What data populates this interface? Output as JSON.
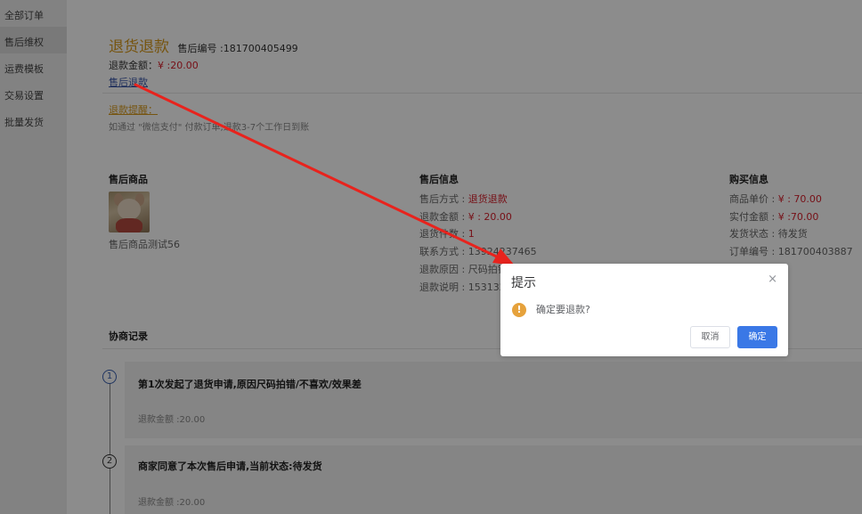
{
  "sidebar": {
    "items": [
      {
        "label": "全部订单"
      },
      {
        "label": "售后维权"
      },
      {
        "label": "运费模板"
      },
      {
        "label": "交易设置"
      },
      {
        "label": "批量发货"
      }
    ]
  },
  "header": {
    "title": "退货退款",
    "number_label": "售后编号 :181700405499",
    "refund_label": "退款金额：",
    "refund_value": "¥ :20.00",
    "link": "售后退款"
  },
  "tip": {
    "title": "退款提醒：",
    "text": "如通过 \"微信支付\" 付款订单,退款3-7个工作日到账"
  },
  "product": {
    "heading": "售后商品",
    "name": "售后商品测试56"
  },
  "aftersale": {
    "heading": "售后信息",
    "method_label": "售后方式 : ",
    "method_value": "退货退款",
    "amount_label": "退款金额 : ",
    "amount_value": "¥ : 20.00",
    "count_label": "退货件数 : ",
    "count_value": "1",
    "contact": "联系方式 : 13924237465",
    "reason": "退款原因 : 尺码拍错/不喜欢/效果差",
    "desc": "退款说明 : 153132"
  },
  "purchase": {
    "heading": "购买信息",
    "price_label": "商品单价 : ",
    "price_value": "¥ : 70.00",
    "paid_label": "实付金额 : ",
    "paid_value": "¥ :70.00",
    "ship": "发货状态 : 待发货",
    "order": "订单编号 : 181700403887"
  },
  "negotiation": {
    "heading": "协商记录",
    "records": [
      {
        "index": "1",
        "title": "第1次发起了退货申请,原因尺码拍错/不喜欢/效果差",
        "amount": "退款金额 :20.00"
      },
      {
        "index": "2",
        "title": "商家同意了本次售后申请,当前状态:待发货",
        "amount": "退款金额 :20.00"
      }
    ]
  },
  "dialog": {
    "title": "提示",
    "close": "×",
    "icon": "warning-icon",
    "icon_glyph": "!",
    "message": "确定要退款?",
    "cancel": "取消",
    "confirm": "确定"
  },
  "colors": {
    "accent": "#d89a1c",
    "price": "#d8202c",
    "primary": "#3a78e6",
    "annotation_arrow": "#e8231d"
  }
}
